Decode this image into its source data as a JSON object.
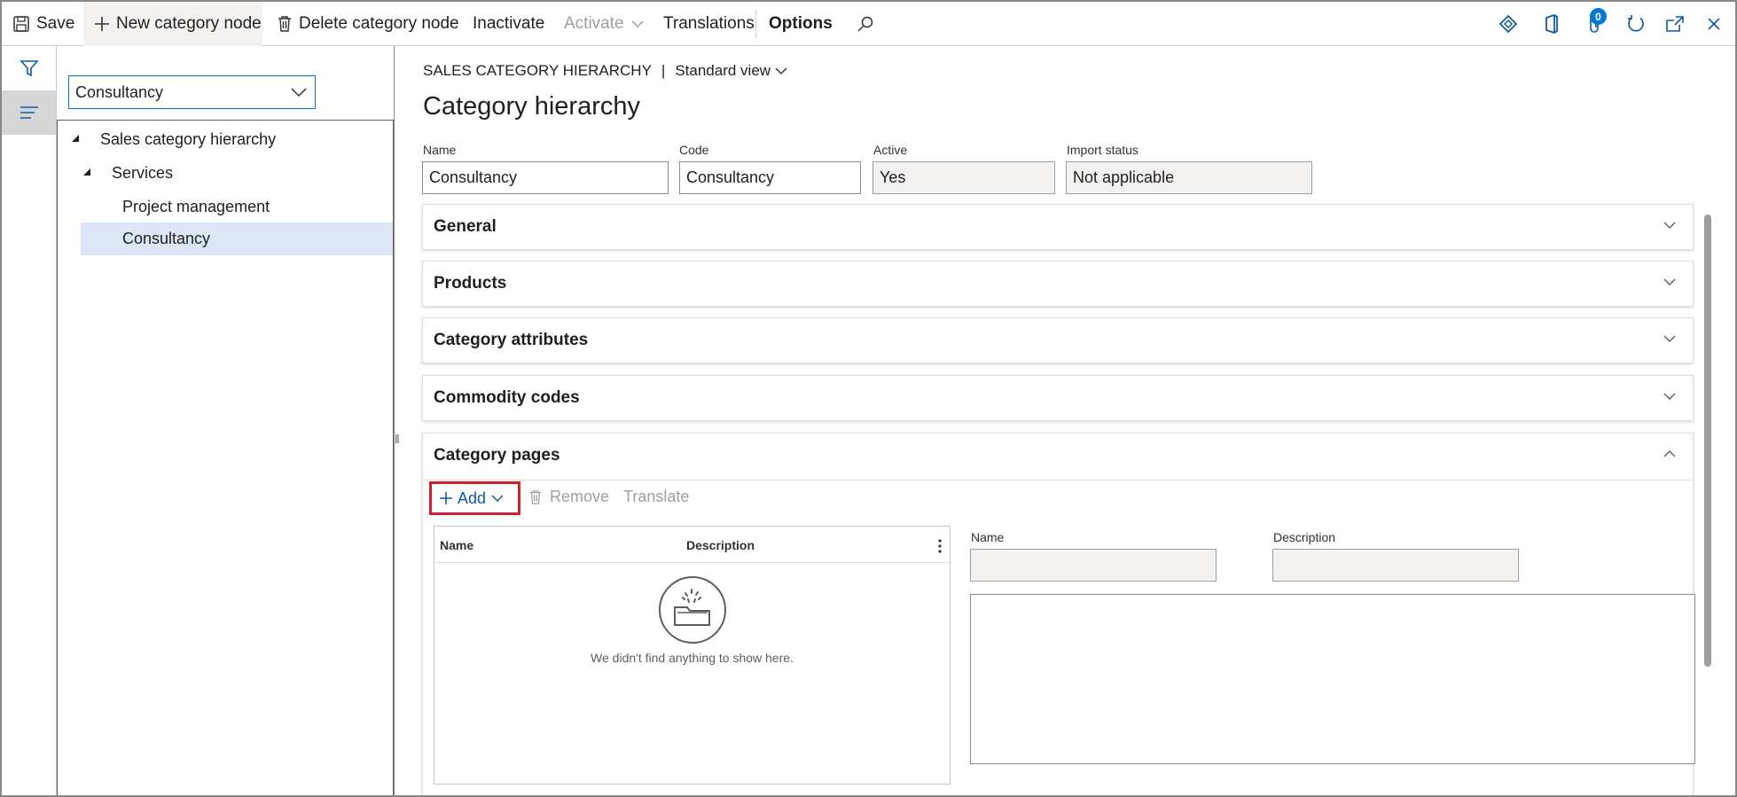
{
  "toolbar": {
    "save": "Save",
    "new_node": "New category node",
    "delete_node": "Delete category node",
    "inactivate": "Inactivate",
    "activate": "Activate",
    "translations": "Translations",
    "options": "Options",
    "notification_count": "0"
  },
  "tree": {
    "selector_value": "Consultancy",
    "nodes": [
      {
        "label": "Sales category hierarchy"
      },
      {
        "label": "Services"
      },
      {
        "label": "Project management"
      },
      {
        "label": "Consultancy"
      }
    ]
  },
  "header": {
    "breadcrumb": "SALES CATEGORY HIERARCHY",
    "separator": "|",
    "view": "Standard view",
    "title": "Category hierarchy"
  },
  "fields": {
    "name_label": "Name",
    "name_value": "Consultancy",
    "code_label": "Code",
    "code_value": "Consultancy",
    "active_label": "Active",
    "active_value": "Yes",
    "import_label": "Import status",
    "import_value": "Not applicable"
  },
  "fasttabs": {
    "general": "General",
    "products": "Products",
    "attributes": "Category attributes",
    "commodity": "Commodity codes",
    "pages": "Category pages"
  },
  "category_pages": {
    "add": "Add",
    "remove": "Remove",
    "translate": "Translate",
    "grid_col_name": "Name",
    "grid_col_description": "Description",
    "empty_message": "We didn't find anything to show here.",
    "detail_name_label": "Name",
    "detail_name_value": "",
    "detail_description_label": "Description",
    "detail_description_value": "",
    "detail_text_value": ""
  }
}
